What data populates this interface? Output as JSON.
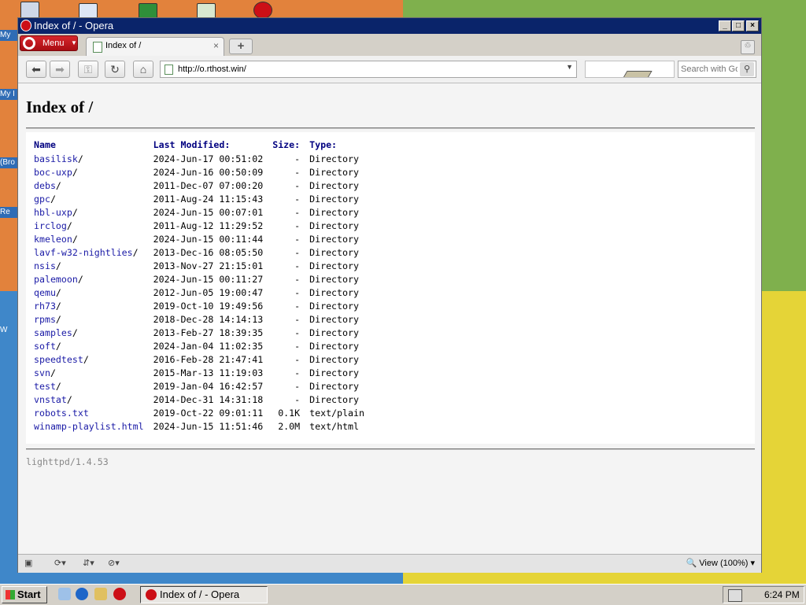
{
  "colors": {
    "title_bar": "#0a246a",
    "link": "#1a1aa6",
    "header_link": "#000080",
    "opera_red": "#cc0f16"
  },
  "window": {
    "title": "Index of / - Opera"
  },
  "tabbar": {
    "menu_label": "Menu",
    "tab_title": "Index of /"
  },
  "navbar": {
    "url": "http://o.rthost.win/",
    "search_placeholder": "Search with Google"
  },
  "page": {
    "title": "Index of /",
    "columns": {
      "name": "Name",
      "modified": "Last Modified:",
      "size": "Size:",
      "type": "Type:"
    },
    "entries": [
      {
        "name": "basilisk",
        "suffix": "/",
        "modified": "2024-Jun-17 00:51:02",
        "size": "-",
        "type": "Directory"
      },
      {
        "name": "boc-uxp",
        "suffix": "/",
        "modified": "2024-Jun-16 00:50:09",
        "size": "-",
        "type": "Directory"
      },
      {
        "name": "debs",
        "suffix": "/",
        "modified": "2011-Dec-07 07:00:20",
        "size": "-",
        "type": "Directory"
      },
      {
        "name": "gpc",
        "suffix": "/",
        "modified": "2011-Aug-24 11:15:43",
        "size": "-",
        "type": "Directory"
      },
      {
        "name": "hbl-uxp",
        "suffix": "/",
        "modified": "2024-Jun-15 00:07:01",
        "size": "-",
        "type": "Directory"
      },
      {
        "name": "irclog",
        "suffix": "/",
        "modified": "2011-Aug-12 11:29:52",
        "size": "-",
        "type": "Directory"
      },
      {
        "name": "kmeleon",
        "suffix": "/",
        "modified": "2024-Jun-15 00:11:44",
        "size": "-",
        "type": "Directory"
      },
      {
        "name": "lavf-w32-nightlies",
        "suffix": "/",
        "modified": "2013-Dec-16 08:05:50",
        "size": "-",
        "type": "Directory"
      },
      {
        "name": "nsis",
        "suffix": "/",
        "modified": "2013-Nov-27 21:15:01",
        "size": "-",
        "type": "Directory"
      },
      {
        "name": "palemoon",
        "suffix": "/",
        "modified": "2024-Jun-15 00:11:27",
        "size": "-",
        "type": "Directory"
      },
      {
        "name": "qemu",
        "suffix": "/",
        "modified": "2012-Jun-05 19:00:47",
        "size": "-",
        "type": "Directory"
      },
      {
        "name": "rh73",
        "suffix": "/",
        "modified": "2019-Oct-10 19:49:56",
        "size": "-",
        "type": "Directory"
      },
      {
        "name": "rpms",
        "suffix": "/",
        "modified": "2018-Dec-28 14:14:13",
        "size": "-",
        "type": "Directory"
      },
      {
        "name": "samples",
        "suffix": "/",
        "modified": "2013-Feb-27 18:39:35",
        "size": "-",
        "type": "Directory"
      },
      {
        "name": "soft",
        "suffix": "/",
        "modified": "2024-Jan-04 11:02:35",
        "size": "-",
        "type": "Directory"
      },
      {
        "name": "speedtest",
        "suffix": "/",
        "modified": "2016-Feb-28 21:47:41",
        "size": "-",
        "type": "Directory"
      },
      {
        "name": "svn",
        "suffix": "/",
        "modified": "2015-Mar-13 11:19:03",
        "size": "-",
        "type": "Directory"
      },
      {
        "name": "test",
        "suffix": "/",
        "modified": "2019-Jan-04 16:42:57",
        "size": "-",
        "type": "Directory"
      },
      {
        "name": "vnstat",
        "suffix": "/",
        "modified": "2014-Dec-31 14:31:18",
        "size": "-",
        "type": "Directory"
      },
      {
        "name": "robots.txt",
        "suffix": "",
        "modified": "2019-Oct-22 09:01:11",
        "size": "0.1K",
        "type": "text/plain"
      },
      {
        "name": "winamp-playlist.html",
        "suffix": "",
        "modified": "2024-Jun-15 11:51:46",
        "size": "2.0M",
        "type": "text/html"
      }
    ],
    "footer": "lighttpd/1.4.53"
  },
  "statusbar": {
    "zoom": "View (100%)"
  },
  "taskbar": {
    "start_label": "Start",
    "task_label": "Index of / - Opera",
    "clock": "6:24 PM"
  },
  "desktop": {
    "labels": [
      "My",
      "My I",
      "(Bro",
      "Re",
      "W"
    ]
  }
}
